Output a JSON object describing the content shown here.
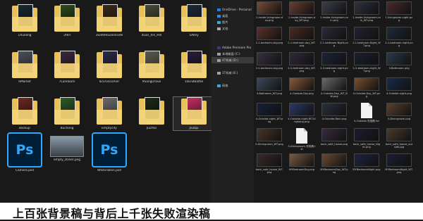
{
  "left_items": [
    {
      "label": "1Xueling",
      "kind": "folder",
      "c1": "#1a2a33",
      "c2": "#0a0e12"
    },
    {
      "label": "2Hill",
      "kind": "folder",
      "c1": "#2e4a1e",
      "c2": "#0e1a08"
    },
    {
      "label": "3SafeHouseInside",
      "kind": "folder",
      "c1": "#3a2a1c",
      "c2": "#1a1008"
    },
    {
      "label": "4Lan_Xin_Hill",
      "kind": "folder",
      "c1": "#4a4a3a",
      "c2": "#1a1a10"
    },
    {
      "label": "5Alley",
      "kind": "folder",
      "c1": "#1c2a3a",
      "c2": "#0c1018"
    },
    {
      "label": "6Market",
      "kind": "folder",
      "c1": "#4a4f5a",
      "c2": "#202328"
    },
    {
      "label": "7LanRoom",
      "kind": "folder",
      "c1": "#3a2a3a",
      "c2": "#1a0e1a"
    },
    {
      "label": "8corvocomer",
      "kind": "folder",
      "c1": "#2a2a4a",
      "c2": "#101020"
    },
    {
      "label": "9SangDrave",
      "kind": "folder",
      "c1": "#5a5a50",
      "c2": "#2a2a22"
    },
    {
      "label": "10EndBattle",
      "kind": "folder",
      "c1": "#2a1e3a",
      "c2": "#0e0a18"
    },
    {
      "label": "Backup",
      "kind": "folder",
      "c1": "#6a2a20",
      "c2": "#2a0e0a"
    },
    {
      "label": "Buchong",
      "kind": "folder",
      "c1": "#2e5a2a",
      "c2": "#10200e"
    },
    {
      "label": "Emptycity",
      "kind": "folder",
      "c1": "#6a6a6a",
      "c2": "#2e2e2e"
    },
    {
      "label": "Jiuzhai",
      "kind": "folder",
      "c1": "#1e2a1a",
      "c2": "#0a0e08"
    },
    {
      "label": "Jiuzqu",
      "kind": "folder",
      "c1": "#c03060",
      "c2": "#4a1028",
      "selected": true
    },
    {
      "label": "Camera.psd",
      "kind": "ps"
    },
    {
      "label": "empty_street.png",
      "kind": "photo",
      "c1": "#8a9aa8",
      "c2": "#3a4048"
    },
    {
      "label": "WhiteTalkin.psd",
      "kind": "ps"
    }
  ],
  "nav_items": [
    {
      "label": "",
      "color": "#000"
    },
    {
      "label": "OneDrive - Personal",
      "color": "#2b7cd3"
    },
    {
      "label": "桌面",
      "color": "#3a8ad8"
    },
    {
      "label": "图片",
      "color": "#4aa0d8"
    },
    {
      "label": "文档",
      "color": "#aaaaaa"
    },
    {
      "label": "",
      "color": "#000"
    },
    {
      "label": "",
      "color": "#000"
    },
    {
      "label": "Adobe Premiere Pro",
      "color": "#3a3a7a"
    },
    {
      "label": "本地磁盘 (C:)",
      "color": "#9aa0a8"
    },
    {
      "label": "4T机械 (D:)",
      "color": "#9aa0a8",
      "highlight": true
    },
    {
      "label": "",
      "color": "#000"
    },
    {
      "label": "1T机械 (E:)",
      "color": "#9aa0a8"
    },
    {
      "label": "",
      "color": "#000"
    },
    {
      "label": "网络",
      "color": "#4aa0d8"
    }
  ],
  "right_items": [
    {
      "label": "1-Inside-livingroom-day.png",
      "kind": "img",
      "c": "#7a4a38"
    },
    {
      "label": "1-Inside-livingroom-day_WT.png",
      "kind": "img",
      "c": "#6a3e30"
    },
    {
      "label": "1-Inside-livingroom-rain.png",
      "kind": "img",
      "c": "#3a3e4a"
    },
    {
      "label": "1-Inside-livingroom-rain_WT.png",
      "kind": "img",
      "c": "#2e3240"
    },
    {
      "label": "1-livingroom-night.png",
      "kind": "img",
      "c": "#4a2a2a"
    },
    {
      "label": "2-1-bedroom-day.png",
      "kind": "img",
      "c": "#5a3028"
    },
    {
      "label": "2-1-bedroom-day_WT.png",
      "kind": "img",
      "c": "#4a2a22"
    },
    {
      "label": "2-1-bedroom-Night.png",
      "kind": "img",
      "c": "#2a2a3a"
    },
    {
      "label": "2-1-bedroom-Night_WT.png",
      "kind": "img",
      "c": "#222232"
    },
    {
      "label": "2-1-bedroom-night.png",
      "kind": "img",
      "c": "#1e2a3a"
    },
    {
      "label": "2-2-bedroom-day.png",
      "kind": "img",
      "c": "#3a3040"
    },
    {
      "label": "2-2-bedroom-day_WT.png",
      "kind": "img",
      "c": "#32283a"
    },
    {
      "label": "2-2-bedroom-night.png",
      "kind": "img",
      "c": "#1a2438"
    },
    {
      "label": "2-2-bedroom-night_WT.png",
      "kind": "img",
      "c": "#1a2030"
    },
    {
      "label": "3-Bathroom.png",
      "kind": "img",
      "c": "#2a3a4a"
    },
    {
      "label": "3-Bathroom_WT.png",
      "kind": "img",
      "c": "#3a4a5a"
    },
    {
      "label": "4-Outside-Day.png",
      "kind": "img",
      "c": "#8a5a3a"
    },
    {
      "label": "4-Outside-Day_WT_BW.png",
      "kind": "img",
      "c": "#6a6a6a"
    },
    {
      "label": "4-Outside-Day_WT.png",
      "kind": "img",
      "c": "#7a5030"
    },
    {
      "label": "4-Outside-night.png",
      "kind": "img",
      "c": "#1a2a4a"
    },
    {
      "label": "4-Outside-night_WT.png",
      "kind": "img",
      "c": "#14203a"
    },
    {
      "label": "4-Outside-night-WT-Xinghong.png",
      "kind": "img",
      "c": "#2a3a6a"
    },
    {
      "label": "4-Outside-Rain.png",
      "kind": "img",
      "c": "#2a3040"
    },
    {
      "label": "4-Outside-完成稿.txt",
      "kind": "doc"
    },
    {
      "label": "5-Diningroom.png",
      "kind": "img",
      "c": "#5a4030"
    },
    {
      "label": "5-Diningroom_WT.png",
      "kind": "img",
      "c": "#4a3426"
    },
    {
      "label": "5-Diningroom-完成稿.txt",
      "kind": "doc"
    },
    {
      "label": "back_safe_house.png",
      "kind": "img",
      "c": "#3a2a40"
    },
    {
      "label": "back_safe_house_Night.png",
      "kind": "img",
      "c": "#1e1a30"
    },
    {
      "label": "back_safe_house_outside.jpg",
      "kind": "img",
      "c": "#4a3a2a"
    },
    {
      "label": "back_safe_house_WT.png",
      "kind": "img",
      "c": "#3a2a2a"
    },
    {
      "label": "MYBedroomDay.png",
      "kind": "img",
      "c": "#7a5a40"
    },
    {
      "label": "MYBedroomDay_WT.png",
      "kind": "img",
      "c": "#6a4a34"
    },
    {
      "label": "MYBedroomNight.png",
      "kind": "img",
      "c": "#1e2440"
    },
    {
      "label": "MYBedroomNight_WT.png",
      "kind": "img",
      "c": "#1a1e34"
    }
  ],
  "caption": "上百张背景稿与背后上千张失败渲染稿"
}
